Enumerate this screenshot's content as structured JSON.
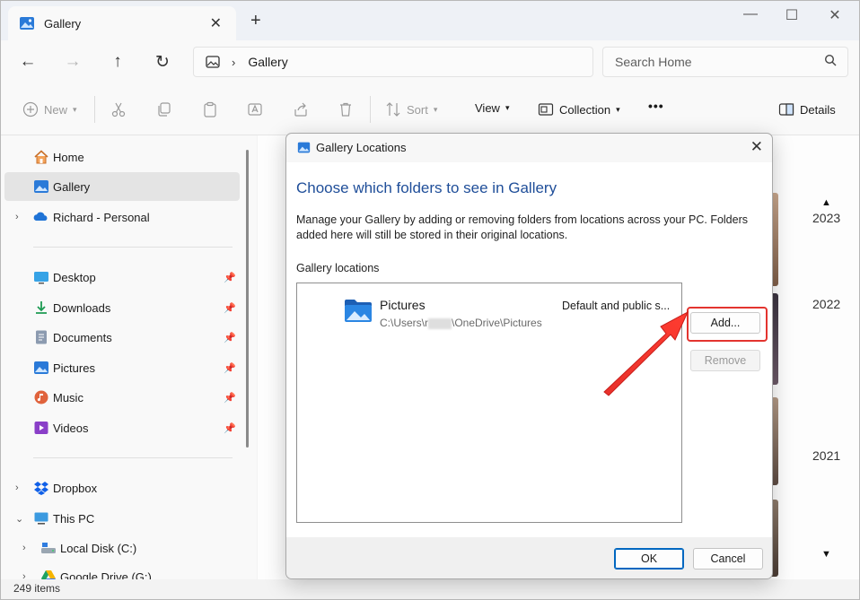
{
  "window": {
    "tab_title": "Gallery",
    "tab_icon": "gallery-icon",
    "new_tab_symbol": "+",
    "controls": {
      "minimize": "—",
      "maximize": "☐",
      "close": "✕"
    }
  },
  "address": {
    "crumb": "Gallery",
    "search_placeholder": "Search Home"
  },
  "commands": {
    "new": "New",
    "sort": "Sort",
    "view": "View",
    "collection": "Collection",
    "more": "•••",
    "details": "Details"
  },
  "sidebar": {
    "top": [
      {
        "label": "Home",
        "icon": "home-icon"
      },
      {
        "label": "Gallery",
        "icon": "gallery-icon",
        "selected": true
      },
      {
        "label": "Richard - Personal",
        "icon": "onedrive-icon"
      }
    ],
    "pinned": [
      {
        "label": "Desktop",
        "icon": "desktop-icon"
      },
      {
        "label": "Downloads",
        "icon": "downloads-icon"
      },
      {
        "label": "Documents",
        "icon": "documents-icon"
      },
      {
        "label": "Pictures",
        "icon": "pictures-icon"
      },
      {
        "label": "Music",
        "icon": "music-icon"
      },
      {
        "label": "Videos",
        "icon": "videos-icon"
      }
    ],
    "bottom": [
      {
        "label": "Dropbox",
        "icon": "dropbox-icon"
      },
      {
        "label": "This PC",
        "icon": "this-pc-icon"
      },
      {
        "label": "Local Disk (C:)",
        "icon": "local-disk-icon"
      },
      {
        "label": "Google Drive (G:)",
        "icon": "google-drive-icon"
      }
    ]
  },
  "status": {
    "items": "249 items"
  },
  "timeline": {
    "years": [
      "2023",
      "2022",
      "2021"
    ]
  },
  "dialog": {
    "title": "Gallery Locations",
    "heading": "Choose which folders to see in Gallery",
    "description": "Manage your Gallery by adding or removing folders from locations across your PC. Folders added here will still be stored in their original locations.",
    "list_label": "Gallery locations",
    "location": {
      "name": "Pictures",
      "path_prefix": "C:\\Users\\r",
      "path_suffix": "\\OneDrive\\Pictures",
      "type": "Default and public s..."
    },
    "add_button": "Add...",
    "remove_button": "Remove",
    "ok_button": "OK",
    "cancel_button": "Cancel"
  },
  "colors": {
    "accent": "#0067c0",
    "heading_blue": "#1f4e99",
    "highlight_red": "#e3342f"
  }
}
